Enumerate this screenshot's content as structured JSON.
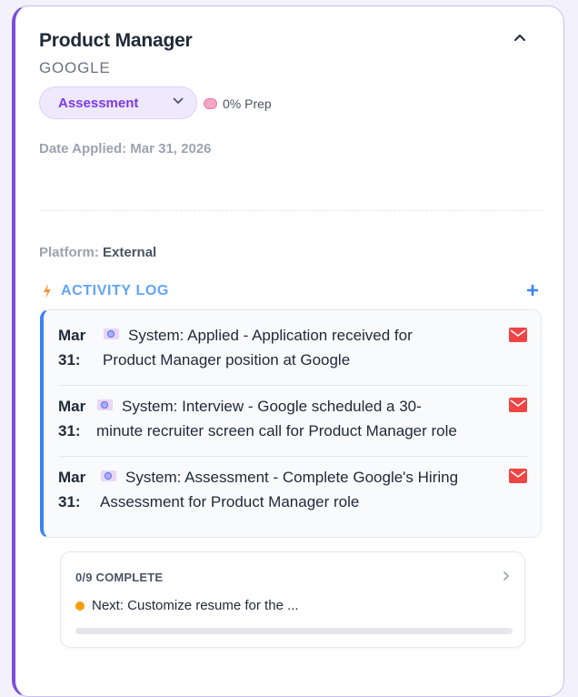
{
  "job": {
    "title": "Product Manager",
    "company": "GOOGLE",
    "status": "Assessment",
    "prep": "0% Prep",
    "date_applied": "Date Applied: Mar 31, 2026",
    "platform_label": "Platform:",
    "platform_value": "External"
  },
  "activity": {
    "title": "ACTIVITY LOG",
    "entries": [
      {
        "date": "Mar 31:",
        "line1": "System: Applied - Application received for",
        "line2": "Product Manager position at Google",
        "icon": "mail-icon"
      },
      {
        "date": "Mar 31:",
        "line1": "System: Interview - Google scheduled a 30-",
        "line2": "minute recruiter screen call for Product Manager role",
        "icon": "mail-icon"
      },
      {
        "date": "Mar 31:",
        "line1": "System: Assessment - Complete Google's Hiring",
        "line2": "Assessment for Product Manager role",
        "icon": "mail-icon"
      }
    ]
  },
  "checklist": {
    "complete": "0/9 COMPLETE",
    "next": "Next: Customize resume for the ...",
    "progress": 0
  },
  "colors": {
    "accent": "#7c4ddb",
    "activity_accent": "#3b82f6",
    "mail": "#ef4444",
    "next_dot": "#f59e0b"
  }
}
